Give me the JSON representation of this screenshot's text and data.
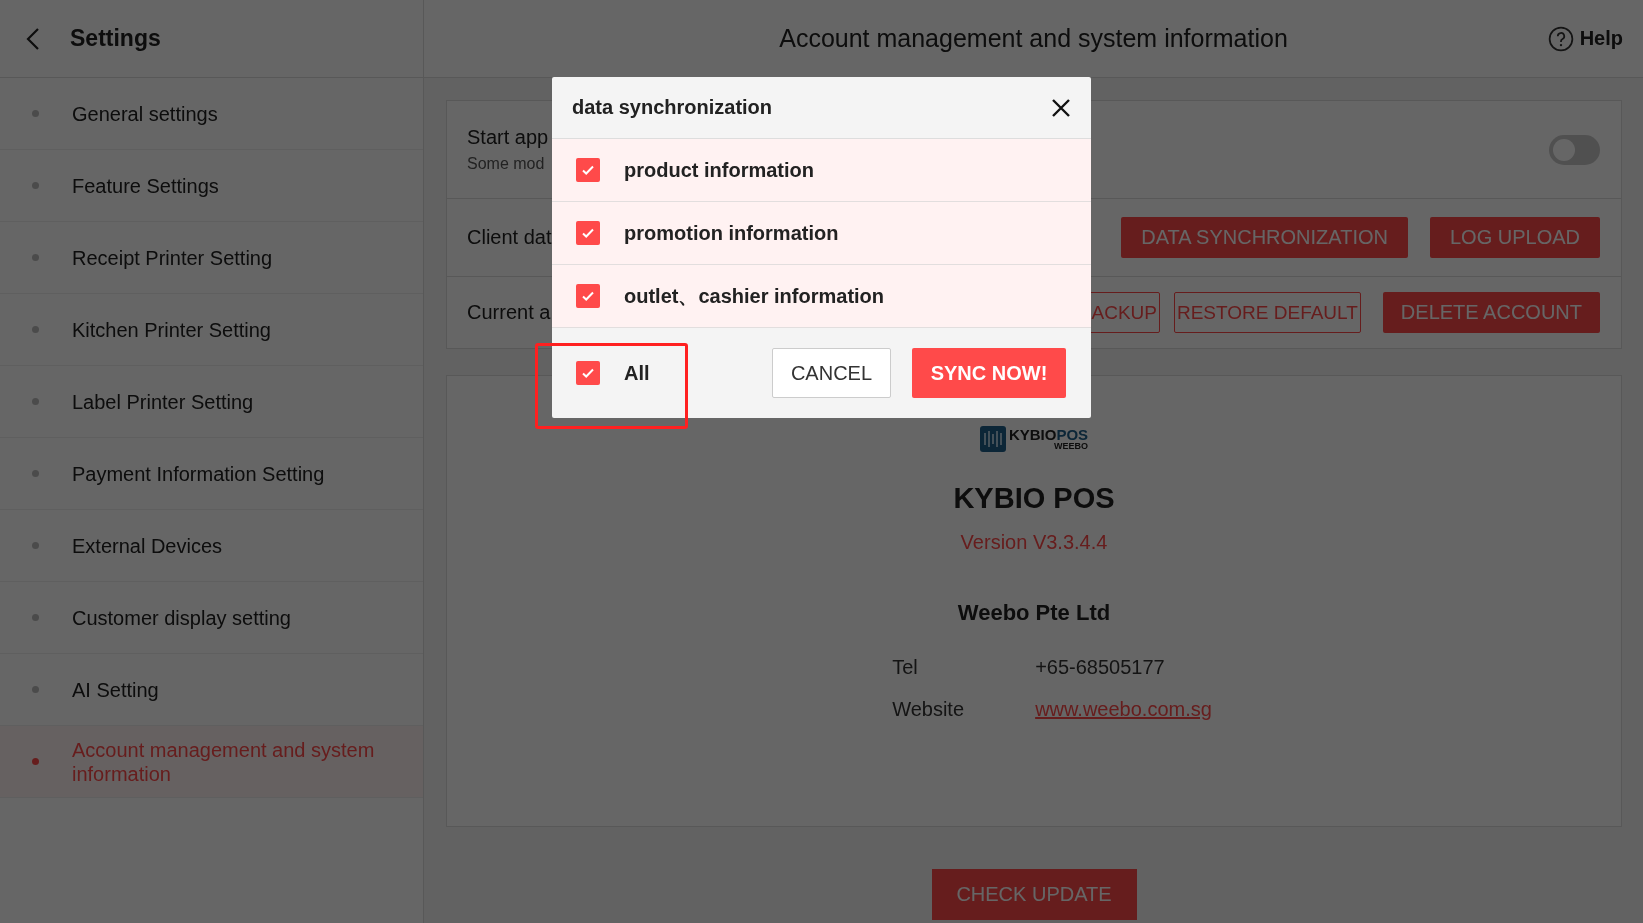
{
  "sidebar": {
    "title": "Settings",
    "items": [
      {
        "label": "General settings",
        "selected": false
      },
      {
        "label": "Feature Settings",
        "selected": false
      },
      {
        "label": "Receipt Printer Setting",
        "selected": false
      },
      {
        "label": "Kitchen Printer Setting",
        "selected": false
      },
      {
        "label": "Label Printer Setting",
        "selected": false
      },
      {
        "label": "Payment Information Setting",
        "selected": false
      },
      {
        "label": "External Devices",
        "selected": false
      },
      {
        "label": "Customer display setting",
        "selected": false
      },
      {
        "label": "AI Setting",
        "selected": false
      },
      {
        "label": "Account management and system information",
        "selected": true
      }
    ]
  },
  "header": {
    "title": "Account management and system information",
    "help": "Help"
  },
  "settings_rows": [
    {
      "kind": "toggle",
      "label": "Start app",
      "sublabel": "Some mod",
      "on": false
    },
    {
      "kind": "buttons",
      "label": "Client dat",
      "buttons": [
        {
          "label": "DATA SYNCHRONIZATION",
          "kind": "filled"
        },
        {
          "label": "LOG UPLOAD",
          "kind": "filled"
        }
      ]
    },
    {
      "kind": "buttons",
      "label": "Current a",
      "buttons": [
        {
          "label": "ACKUP",
          "kind": "outline"
        },
        {
          "label": "RESTORE DEFAULT",
          "kind": "outline"
        },
        {
          "label": "DELETE ACCOUNT",
          "kind": "filled"
        }
      ]
    }
  ],
  "about": {
    "logo": {
      "brand": "KYBIO",
      "accent": "POS",
      "tagline": "WEEBO"
    },
    "product": "KYBIO POS",
    "version": "Version V3.3.4.4",
    "company": "Weebo Pte Ltd",
    "contacts": [
      {
        "label": "Tel",
        "value": "+65-68505177",
        "kind": "text"
      },
      {
        "label": "Website",
        "value": "www.weebo.com.sg",
        "kind": "link"
      }
    ]
  },
  "check_update": "CHECK UPDATE",
  "dialog": {
    "title": "data synchronization",
    "options": [
      {
        "label": "product information",
        "checked": true
      },
      {
        "label": "promotion information",
        "checked": true
      },
      {
        "label": "outlet、cashier information",
        "checked": true
      }
    ],
    "all": {
      "label": "All",
      "checked": true
    },
    "buttons": [
      {
        "label": "CANCEL",
        "kind": "secondary"
      },
      {
        "label": "SYNC NOW!",
        "kind": "primary"
      }
    ]
  }
}
